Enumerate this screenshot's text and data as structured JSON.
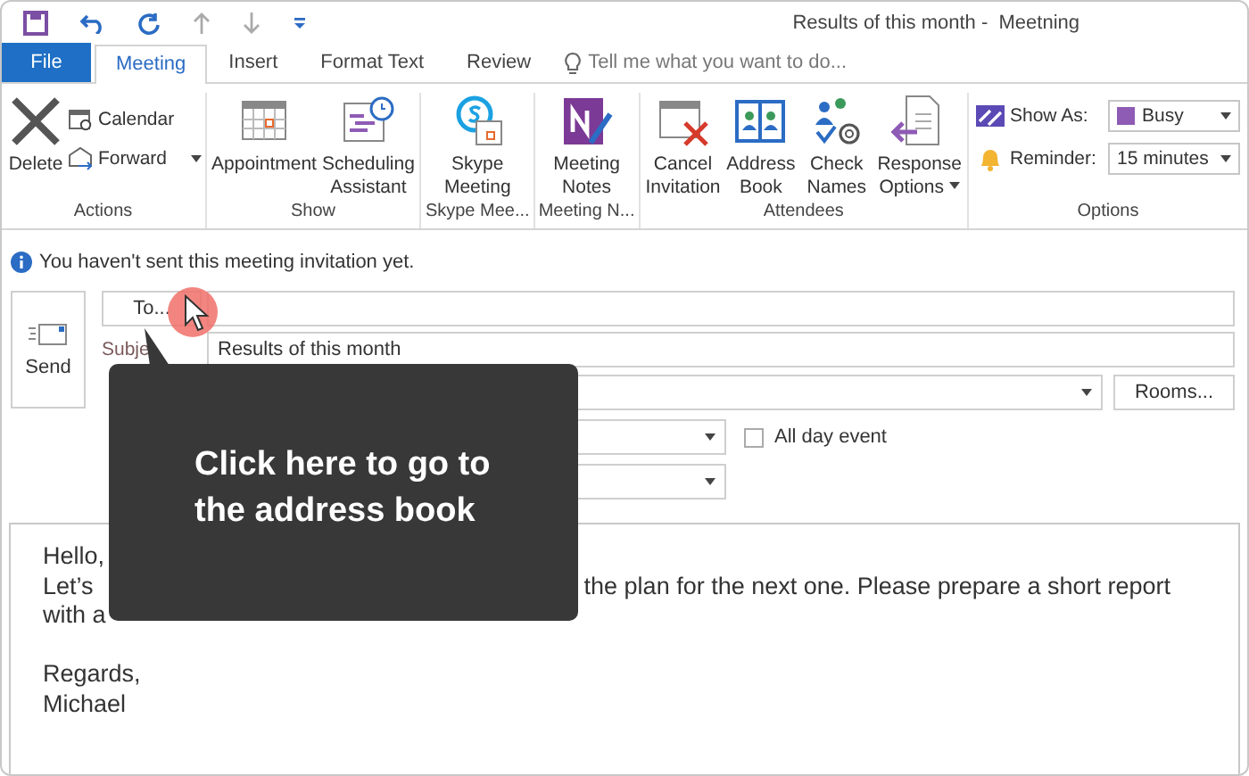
{
  "window": {
    "title": "Results of this month -  Meetning"
  },
  "tabs": [
    {
      "label": "File",
      "kind": "file",
      "selected": false
    },
    {
      "label": "Meeting",
      "kind": "tab",
      "selected": true
    },
    {
      "label": "Insert",
      "kind": "tab",
      "selected": false
    },
    {
      "label": "Format Text",
      "kind": "tab",
      "selected": false
    },
    {
      "label": "Review",
      "kind": "tab",
      "selected": false
    }
  ],
  "tell_me": {
    "placeholder": "Tell me what you want to do..."
  },
  "ribbon_groups": [
    {
      "label": "Actions",
      "commands": [
        {
          "kind": "large",
          "label": "Delete"
        },
        {
          "kind": "small",
          "label": "Calendar",
          "dropdown": false
        },
        {
          "kind": "small",
          "label": "Forward",
          "dropdown": true
        }
      ]
    },
    {
      "label": "Show",
      "commands": [
        {
          "kind": "large",
          "label": "Appointment"
        },
        {
          "kind": "large",
          "label": "Scheduling Assistant"
        }
      ]
    },
    {
      "label": "Skype Mee...",
      "commands": [
        {
          "kind": "large",
          "label": "Skype Meeting"
        }
      ]
    },
    {
      "label": "Meeting N...",
      "commands": [
        {
          "kind": "large",
          "label": "Meeting Notes"
        }
      ]
    },
    {
      "label": "Attendees",
      "commands": [
        {
          "kind": "large",
          "label": "Cancel Invitation"
        },
        {
          "kind": "large",
          "label": "Address Book"
        },
        {
          "kind": "large",
          "label": "Check Names"
        },
        {
          "kind": "large",
          "label": "Response Options",
          "dropdown": true
        }
      ]
    },
    {
      "label": "Options",
      "commands": [
        {
          "kind": "option",
          "label": "Show As:",
          "value": "Busy",
          "color": "#8e5bb5"
        },
        {
          "kind": "option",
          "label": "Reminder:",
          "value": "15 minutes"
        }
      ]
    }
  ],
  "info_bar": "You haven't sent this meeting invitation yet.",
  "send_button": "Send",
  "to_button": "To...",
  "subject": {
    "label": "Subje",
    "value": "Results of this month"
  },
  "location": {
    "button": "Rooms..."
  },
  "all_day": {
    "label": "All day event",
    "checked": false
  },
  "body": [
    {
      "lines": [
        [
          "Hello,"
        ],
        [
          "Let’s",
          "the plan for the next one. Please prepare a short report"
        ],
        [
          "with a"
        ]
      ]
    },
    {
      "lines": [
        [
          "Regards,"
        ],
        [
          "Michael"
        ]
      ]
    }
  ],
  "tooltip": "Click here to go to the address book"
}
